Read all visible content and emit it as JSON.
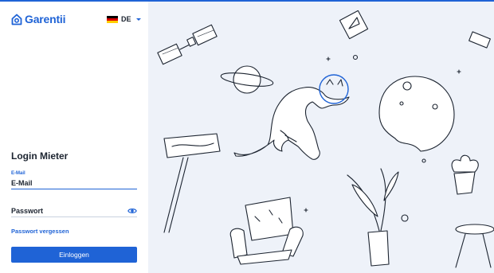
{
  "brand": {
    "name": "Garentii"
  },
  "language": {
    "code": "DE",
    "flag_colors": [
      "#000000",
      "#dd0000",
      "#ffce00"
    ]
  },
  "login": {
    "title": "Login Mieter",
    "email_small_label": "E-Mail",
    "email_placeholder": "E-Mail",
    "password_placeholder": "Passwort",
    "forgot_link": "Passwort vergessen",
    "submit_label": "Einloggen"
  },
  "colors": {
    "accent": "#1f63d6",
    "illustration_bg": "#eef2f9",
    "line": "#1c2430"
  },
  "icons": {
    "logo": "house-logo-icon",
    "language": "chevron-down-icon",
    "password_visibility": "eye-icon"
  }
}
